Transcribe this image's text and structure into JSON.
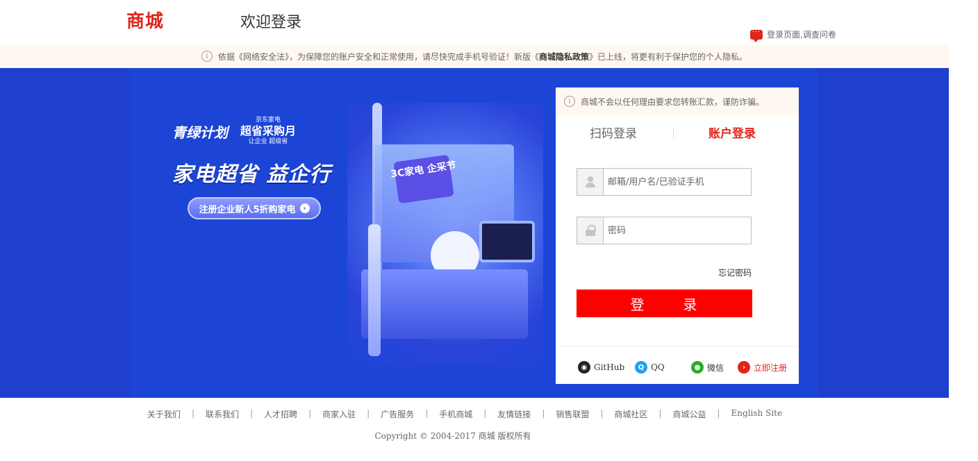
{
  "header": {
    "logo": "商城",
    "welcome": "欢迎登录",
    "survey_label": "登录页面,调查问卷",
    "survey_icon": "chat-bubble-icon"
  },
  "notice": {
    "text_before": "依据《网络安全法》，为保障您的账户安全和正常使用，请尽快完成手机号验证！新版《",
    "policy_name": "商城隐私政策",
    "text_after": "》已上线，将更有利于保护您的个人隐私。"
  },
  "promo": {
    "logo1": "青绿计划",
    "logo2_small": "京东家电",
    "logo2_big": "超省采购月",
    "logo2_sub": "让企业 超级省",
    "title": "家电超省 益企行",
    "button_label": "注册企业新人5折购家电",
    "scene_sign": "3C家电 企采节",
    "colors": {
      "banner_bg": "#1f3fcf"
    }
  },
  "login": {
    "warning": "商城不会以任何理由要求您转账汇款，谨防诈骗。",
    "tab_qr": "扫码登录",
    "tab_account": "账户登录",
    "username_placeholder": "邮箱/用户名/已验证手机",
    "password_placeholder": "密码",
    "forgot": "忘记密码",
    "submit": "登　录",
    "social": {
      "github": "GitHub",
      "qq": "QQ",
      "wechat": "微信",
      "register": "立即注册"
    }
  },
  "footer": {
    "links": [
      "关于我们",
      "联系我们",
      "人才招聘",
      "商家入驻",
      "广告服务",
      "手机商城",
      "友情链接",
      "销售联盟",
      "商城社区",
      "商城公益",
      "English Site"
    ],
    "copyright": "Copyright © 2004-2017 商城 版权所有"
  },
  "colors": {
    "brand_red": "#e1251b",
    "login_button": "#ff0000"
  }
}
